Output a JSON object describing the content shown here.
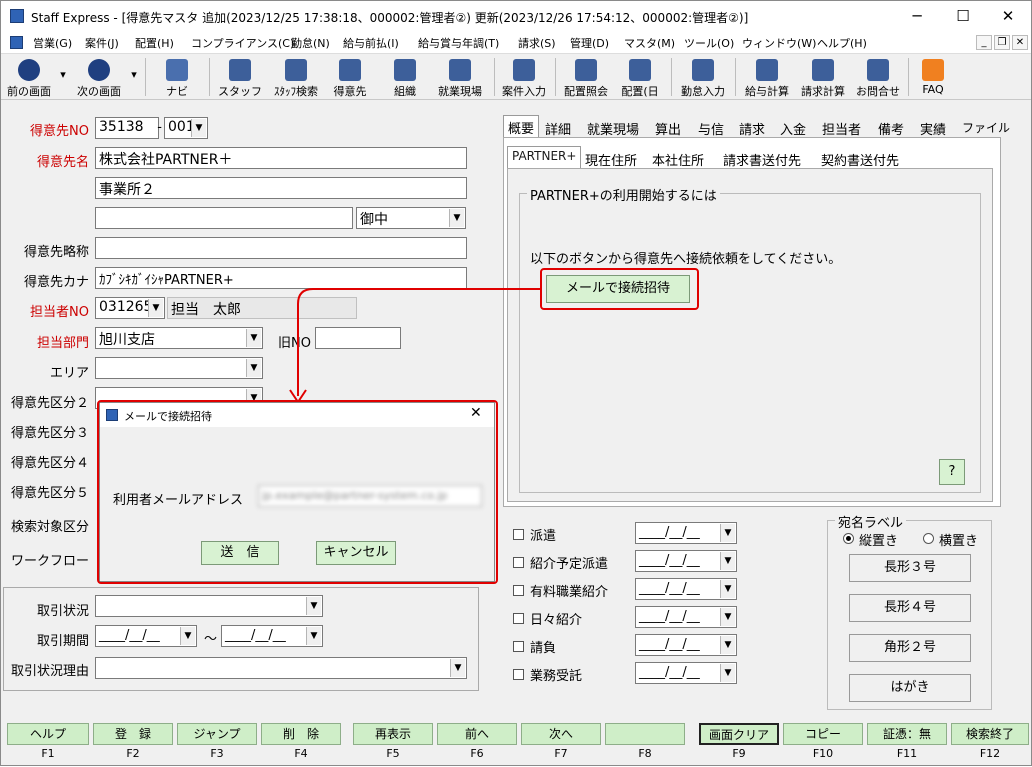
{
  "window": {
    "title": "Staff Express - [得意先マスタ  追加(2023/12/25 17:38:18、000002:管理者②)  更新(2023/12/26 17:54:12、000002:管理者②)]",
    "min": "─",
    "max": "☐",
    "close": "✕"
  },
  "menu": [
    "営業(G)",
    "案件(J)",
    "配置(H)",
    "コンプライアンス(C)",
    "勤怠(N)",
    "給与前払(I)",
    "給与賞与年調(T)",
    "請求(S)",
    "管理(D)",
    "マスタ(M)",
    "ツール(O)",
    "ウィンドウ(W)",
    "ヘルプ(H)"
  ],
  "mdi": {
    "min": "_",
    "restore": "❐",
    "close": "✕"
  },
  "toolbar": [
    "前の画面",
    "次の画面",
    "ナビ",
    "スタッフ",
    "ｽﾀｯﾌ検索",
    "得意先",
    "組織",
    "就業現場",
    "案件入力",
    "配置照会",
    "配置(日",
    "勤怠入力",
    "給与計算",
    "請求計算",
    "お問合せ",
    "FAQ"
  ],
  "form": {
    "no_label": "得意先NO",
    "no_value": "35138",
    "no_dash": "-",
    "no_sub": "001",
    "name_label": "得意先名",
    "name1": "株式会社PARTNER＋",
    "name2": "事業所２",
    "name3": "",
    "honorific": "御中",
    "short_label": "得意先略称",
    "short_value": "",
    "kana_label": "得意先カナ",
    "kana_value": "ｶﾌﾞｼｷｶﾞｲｼｬPARTNER+",
    "staff_label": "担当者NO",
    "staff_no": "031265",
    "staff_name": "担当　太郎",
    "dept_label": "担当部門",
    "dept_value": "旭川支店",
    "old_no_label": "旧NO",
    "area_label": "エリア",
    "cat2_label": "得意先区分２",
    "cat3_label": "得意先区分３",
    "cat4_label": "得意先区分４",
    "cat5_label": "得意先区分５",
    "search_label": "検索対象区分",
    "workflow_label": "ワークフロー",
    "deal_status_label": "取引状況",
    "deal_period_label": "取引期間",
    "deal_tilde": "～",
    "deal_reason_label": "取引状況理由",
    "date_placeholder": "____/__/__"
  },
  "tabs": [
    "概要",
    "詳細",
    "就業現場",
    "算出",
    "与信",
    "請求",
    "入金",
    "担当者",
    "備考",
    "実績",
    "ファイル"
  ],
  "subtabs": [
    "PARTNER+",
    "現在住所",
    "本社住所",
    "請求書送付先",
    "契約書送付先"
  ],
  "partner": {
    "group_title": "PARTNER+の利用開始するには",
    "instruction": "以下のボタンから得意先へ接続依頼をしてください。",
    "invite_button": "メールで接続招待",
    "help_button": "?"
  },
  "dialog": {
    "title": "メールで接続招待",
    "close": "✕",
    "email_label": "利用者メールアドレス",
    "email_value": "jp.example@partner-system.co.jp",
    "send": "送　信",
    "cancel": "キャンセル"
  },
  "checks": [
    "派遣",
    "紹介予定派遣",
    "有料職業紹介",
    "日々紹介",
    "請負",
    "業務受託"
  ],
  "label_group": {
    "title": "宛名ラベル",
    "vertical": "縦置き",
    "horizontal": "横置き",
    "buttons": [
      "長形３号",
      "長形４号",
      "角形２号",
      "はがき"
    ]
  },
  "fkeys": [
    {
      "label": "ヘルプ",
      "key": "F1"
    },
    {
      "label": "登　録",
      "key": "F2"
    },
    {
      "label": "ジャンプ",
      "key": "F3"
    },
    {
      "label": "削　除",
      "key": "F4"
    },
    {
      "label": "再表示",
      "key": "F5"
    },
    {
      "label": "前へ",
      "key": "F6"
    },
    {
      "label": "次へ",
      "key": "F7"
    },
    {
      "label": "",
      "key": "F8"
    },
    {
      "label": "画面クリア",
      "key": "F9"
    },
    {
      "label": "コピー",
      "key": "F10"
    },
    {
      "label": "証憑：無",
      "key": "F11"
    },
    {
      "label": "検索終了",
      "key": "F12"
    }
  ],
  "colors": {
    "accent_red": "#e00000",
    "label_red": "#cc0000",
    "button_green": "#d8f2d2"
  }
}
